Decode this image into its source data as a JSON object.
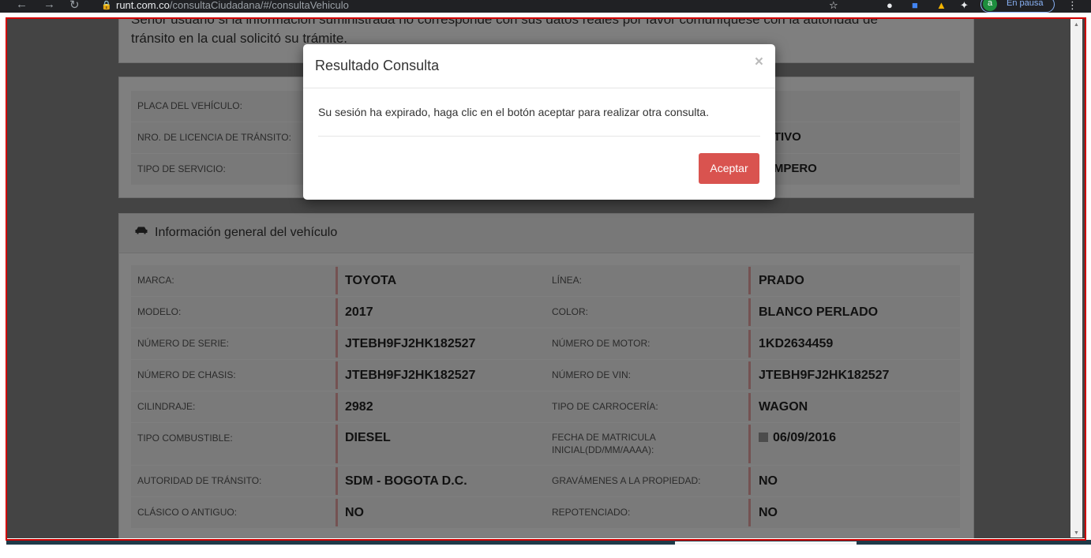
{
  "browser": {
    "url_host": "runt.com.co",
    "url_path": "/consultaCiudadana/#/consultaVehiculo",
    "profile_initial": "a",
    "profile_status": "En pausa"
  },
  "notice": {
    "line1": "Señor usuario si la información suministrada no corresponde con sus datos reales por favor comuníquese con la autoridad de",
    "line2": "tránsito en la cual solicitó su trámite."
  },
  "summary": {
    "rows": [
      {
        "label": "PLACA DEL VEHÍCULO:",
        "right_value": ""
      },
      {
        "label": "NRO. DE LICENCIA DE TRÁNSITO:",
        "right_value": "CTIVO"
      },
      {
        "label": "TIPO DE SERVICIO:",
        "right_value": "AMPERO"
      }
    ]
  },
  "info": {
    "title": "Información general del vehículo",
    "rows": [
      {
        "l1": "MARCA:",
        "v1": "TOYOTA",
        "l2": "LÍNEA:",
        "v2": "PRADO"
      },
      {
        "l1": "MODELO:",
        "v1": "2017",
        "l2": "COLOR:",
        "v2": "BLANCO PERLADO"
      },
      {
        "l1": "NÚMERO DE SERIE:",
        "v1": "JTEBH9FJ2HK182527",
        "l2": "NÚMERO DE MOTOR:",
        "v2": "1KD2634459"
      },
      {
        "l1": "NÚMERO DE CHASIS:",
        "v1": "JTEBH9FJ2HK182527",
        "l2": "NÚMERO DE VIN:",
        "v2": "JTEBH9FJ2HK182527"
      },
      {
        "l1": "CILINDRAJE:",
        "v1": "2982",
        "l2": "TIPO DE CARROCERÍA:",
        "v2": "WAGON"
      },
      {
        "l1": "TIPO COMBUSTIBLE:",
        "v1": "DIESEL",
        "l2": "FECHA DE MATRICULA INICIAL(DD/MM/AAAA):",
        "v2": "06/09/2016"
      },
      {
        "l1": "AUTORIDAD DE TRÁNSITO:",
        "v1": "SDM - BOGOTA D.C.",
        "l2": "GRAVÁMENES A LA PROPIEDAD:",
        "v2": "NO"
      },
      {
        "l1": "CLÁSICO O ANTIGUO:",
        "v1": "NO",
        "l2": "REPOTENCIADO:",
        "v2": "NO"
      }
    ]
  },
  "modal": {
    "title": "Resultado Consulta",
    "close": "×",
    "message": "Su sesión ha expirado, haga clic en el botón aceptar para realizar otra consulta.",
    "accept": "Aceptar"
  }
}
